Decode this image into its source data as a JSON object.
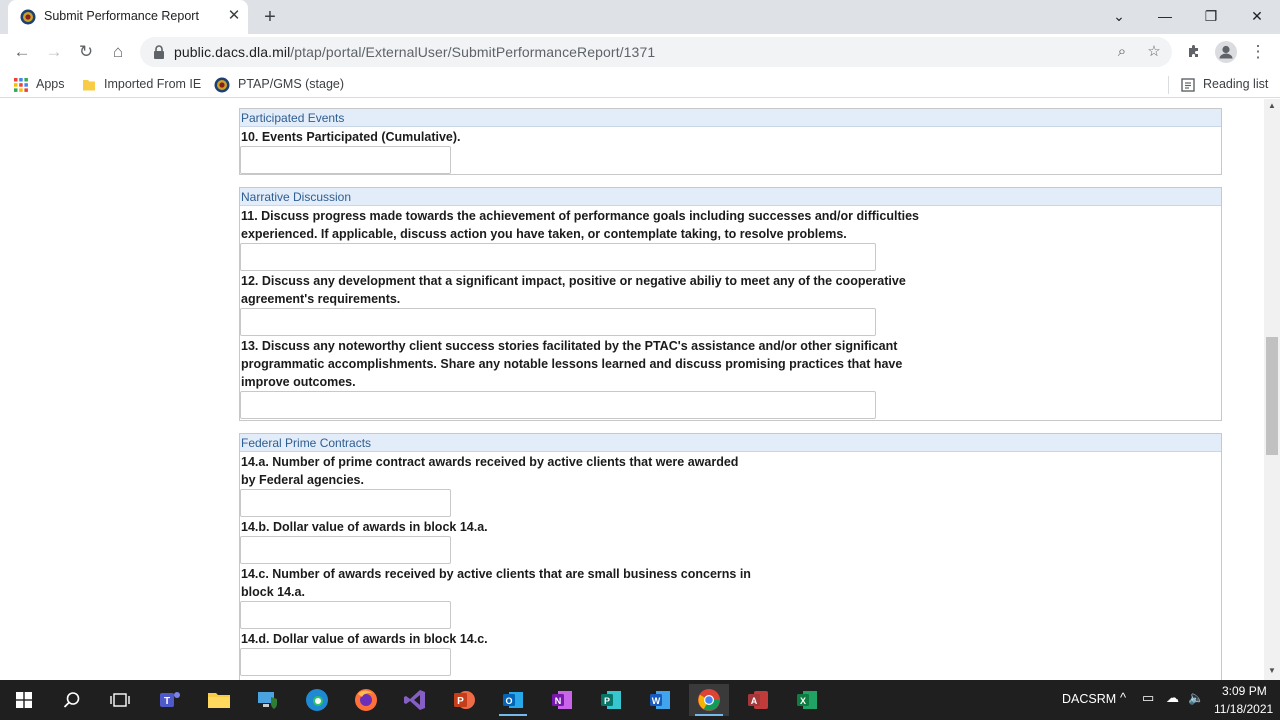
{
  "browser": {
    "tab_title": "Submit Performance Report",
    "url_host": "public.dacs.dla.mil",
    "url_path": "/ptap/portal/ExternalUser/SubmitPerformanceReport/1371",
    "bookmarks": [
      "Apps",
      "Imported From IE",
      "PTAP/GMS (stage)"
    ],
    "reading_list": "Reading list"
  },
  "form": {
    "participated_events": {
      "header": "Participated Events",
      "q10": "10. Events Participated (Cumulative).",
      "q10_value": ""
    },
    "narrative": {
      "header": "Narrative Discussion",
      "q11_line1": "11. Discuss progress made towards the achievement of performance goals including successes and/or difficulties",
      "q11_line2": "experienced. If applicable, discuss action you have taken, or contemplate taking, to resolve problems.",
      "q12_line1": "12. Discuss any development that a significant impact, positive or negative abiliy to meet any of the cooperative",
      "q12_line2": "agreement's requirements.",
      "q13_line1": "13. Discuss any noteworthy client success stories facilitated by the PTAC's assistance and/or other significant",
      "q13_line2": "programmatic accomplishments. Share any notable lessons learned and discuss promising practices that have",
      "q13_line3": "improve outcomes."
    },
    "federal_prime": {
      "header": "Federal Prime Contracts",
      "q14a_line1": "14.a. Number of prime contract awards received by active clients that were awarded",
      "q14a_line2": "by Federal agencies.",
      "q14b": "14.b. Dollar value of awards in block 14.a.",
      "q14c_line1": "14.c. Number of awards received by active clients that are small business concerns in",
      "q14c_line2": "block 14.a.",
      "q14d": "14.d. Dollar value of awards in block 14.c."
    }
  },
  "taskbar": {
    "tray_label": "DACSRM",
    "time": "3:09 PM",
    "date": "11/18/2021"
  }
}
